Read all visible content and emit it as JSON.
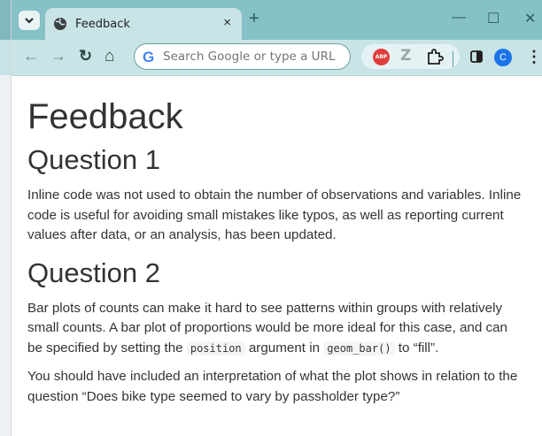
{
  "browser": {
    "tab_title": "Feedback",
    "tab_close": "×",
    "new_tab": "+",
    "minimize": "—",
    "maximize": "☐",
    "close": "✕",
    "omnibox_placeholder": "Search Google or type a URL",
    "omnibox_g": "G",
    "adblock_label": "ABP",
    "zotero_label": "Z",
    "avatar_letter": "C",
    "back": "←",
    "forward": "→",
    "reload": "↻",
    "home": "⌂",
    "menu": "⋮",
    "colors": {
      "titlebar": "#85c1c6",
      "toolbar": "#c9e4e6",
      "avatar": "#1a73e8",
      "adblock": "#e13c3c"
    }
  },
  "page": {
    "title": "Feedback",
    "q1": {
      "heading": "Question 1",
      "text": "Inline code was not used to obtain the number of observations and variables. Inline code is useful for avoiding small mistakes like typos, as well as reporting current values after data, or an analysis, has been updated."
    },
    "q2": {
      "heading": "Question 2",
      "p1_before": "Bar plots of counts can make it hard to see patterns within groups with relatively small counts. A bar plot of proportions would be more ideal for this case, and can be specified by setting the ",
      "p1_code1": "position",
      "p1_mid": " argument in ",
      "p1_code2": "geom_bar()",
      "p1_after": " to “fill”.",
      "p2": "You should have included an interpretation of what the plot shows in relation to the question “Does bike type seemed to vary by passholder type?”"
    }
  }
}
